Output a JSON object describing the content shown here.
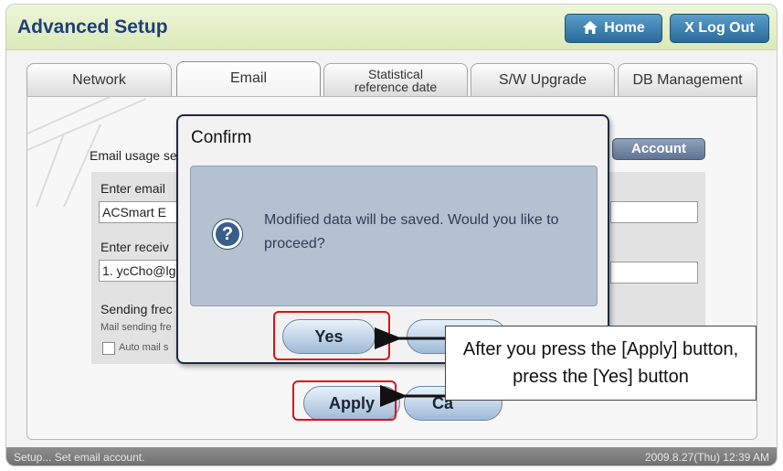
{
  "header": {
    "title": "Advanced Setup",
    "home_label": "Home",
    "logout_label": "X Log Out"
  },
  "tabs": [
    {
      "label": "Network"
    },
    {
      "label": "Email",
      "active": true
    },
    {
      "label_line1": "Statistical",
      "label_line2": "reference date"
    },
    {
      "label": "S/W Upgrade"
    },
    {
      "label": "DB Management"
    }
  ],
  "email_panel": {
    "usage_label": "Email usage se",
    "account_button": "Account",
    "sender_label": "Enter email",
    "sender_value": "ACSmart E",
    "receiver_label": "Enter receiv",
    "receiver_value": "1. ycCho@lg",
    "frequency_label": "Sending frec",
    "frequency_sub": "Mail sending fre",
    "auto_mail_label": "Auto mail s",
    "apply_button": "Apply",
    "cancel_button": "Ca"
  },
  "dialog": {
    "title": "Confirm",
    "message": "Modified data will be saved.  Would you like to proceed?",
    "yes_button": "Yes",
    "no_button": ""
  },
  "callout": {
    "text": "After you press the [Apply] button, press the [Yes] button"
  },
  "status": {
    "message": "Setup... Set email account.",
    "datetime": "2009.8.27(Thu)  12:39 AM"
  },
  "colors": {
    "header_bg": "#dbe9b8",
    "title_text": "#1e3f78",
    "highlight_red": "#e01010",
    "dialog_body": "#b3c1d0"
  }
}
